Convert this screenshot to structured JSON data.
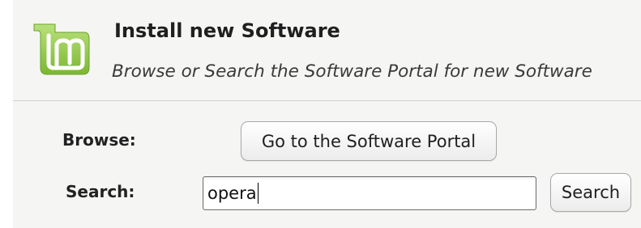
{
  "header": {
    "title": "Install new Software",
    "subtitle": "Browse or Search the Software Portal for new Software",
    "logo_icon": "linux-mint-logo-icon"
  },
  "browse": {
    "label": "Browse:",
    "button_label": "Go to the Software Portal"
  },
  "search": {
    "label": "Search:",
    "input_value": "opera",
    "button_label": "Search"
  },
  "colors": {
    "logo_green": "#8cc63f",
    "logo_green_light": "#b7e07a"
  }
}
